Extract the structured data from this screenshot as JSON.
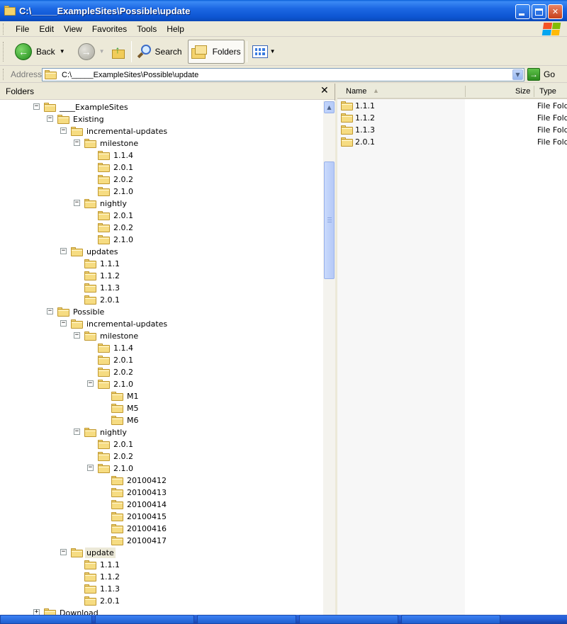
{
  "window": {
    "title": "C:\\_____ExampleSites\\Possible\\update"
  },
  "menu": [
    "File",
    "Edit",
    "View",
    "Favorites",
    "Tools",
    "Help"
  ],
  "toolbar": {
    "back_label": "Back",
    "search_label": "Search",
    "folders_label": "Folders"
  },
  "address": {
    "label": "Address",
    "value": "C:\\_____ExampleSites\\Possible\\update",
    "go_label": "Go"
  },
  "folders_pane": {
    "title": "Folders",
    "tree": [
      {
        "label": "____ExampleSites",
        "level": 0,
        "expander": "−"
      },
      {
        "label": "Existing",
        "level": 1,
        "expander": "−"
      },
      {
        "label": "incremental-updates",
        "level": 2,
        "expander": "−"
      },
      {
        "label": "milestone",
        "level": 3,
        "expander": "−"
      },
      {
        "label": "1.1.4",
        "level": 4,
        "expander": ""
      },
      {
        "label": "2.0.1",
        "level": 4,
        "expander": ""
      },
      {
        "label": "2.0.2",
        "level": 4,
        "expander": ""
      },
      {
        "label": "2.1.0",
        "level": 4,
        "expander": ""
      },
      {
        "label": "nightly",
        "level": 3,
        "expander": "−"
      },
      {
        "label": "2.0.1",
        "level": 4,
        "expander": ""
      },
      {
        "label": "2.0.2",
        "level": 4,
        "expander": ""
      },
      {
        "label": "2.1.0",
        "level": 4,
        "expander": ""
      },
      {
        "label": "updates",
        "level": 2,
        "expander": "−"
      },
      {
        "label": "1.1.1",
        "level": 3,
        "expander": ""
      },
      {
        "label": "1.1.2",
        "level": 3,
        "expander": ""
      },
      {
        "label": "1.1.3",
        "level": 3,
        "expander": ""
      },
      {
        "label": "2.0.1",
        "level": 3,
        "expander": ""
      },
      {
        "label": "Possible",
        "level": 1,
        "expander": "−"
      },
      {
        "label": "incremental-updates",
        "level": 2,
        "expander": "−"
      },
      {
        "label": "milestone",
        "level": 3,
        "expander": "−"
      },
      {
        "label": "1.1.4",
        "level": 4,
        "expander": ""
      },
      {
        "label": "2.0.1",
        "level": 4,
        "expander": ""
      },
      {
        "label": "2.0.2",
        "level": 4,
        "expander": ""
      },
      {
        "label": "2.1.0",
        "level": 4,
        "expander": "−"
      },
      {
        "label": "M1",
        "level": 5,
        "expander": ""
      },
      {
        "label": "M5",
        "level": 5,
        "expander": ""
      },
      {
        "label": "M6",
        "level": 5,
        "expander": ""
      },
      {
        "label": "nightly",
        "level": 3,
        "expander": "−"
      },
      {
        "label": "2.0.1",
        "level": 4,
        "expander": ""
      },
      {
        "label": "2.0.2",
        "level": 4,
        "expander": ""
      },
      {
        "label": "2.1.0",
        "level": 4,
        "expander": "−"
      },
      {
        "label": "20100412",
        "level": 5,
        "expander": ""
      },
      {
        "label": "20100413",
        "level": 5,
        "expander": ""
      },
      {
        "label": "20100414",
        "level": 5,
        "expander": ""
      },
      {
        "label": "20100415",
        "level": 5,
        "expander": ""
      },
      {
        "label": "20100416",
        "level": 5,
        "expander": ""
      },
      {
        "label": "20100417",
        "level": 5,
        "expander": ""
      },
      {
        "label": "update",
        "level": 2,
        "expander": "−",
        "selected": true
      },
      {
        "label": "1.1.1",
        "level": 3,
        "expander": ""
      },
      {
        "label": "1.1.2",
        "level": 3,
        "expander": ""
      },
      {
        "label": "1.1.3",
        "level": 3,
        "expander": ""
      },
      {
        "label": "2.0.1",
        "level": 3,
        "expander": ""
      },
      {
        "label": "Download",
        "level": 0,
        "expander": "+"
      }
    ]
  },
  "list_pane": {
    "columns": {
      "name": "Name",
      "size": "Size",
      "type": "Type"
    },
    "items": [
      {
        "name": "1.1.1",
        "size": "",
        "type": "File Folder"
      },
      {
        "name": "1.1.2",
        "size": "",
        "type": "File Folder"
      },
      {
        "name": "1.1.3",
        "size": "",
        "type": "File Folder"
      },
      {
        "name": "2.0.1",
        "size": "",
        "type": "File Folder"
      }
    ]
  },
  "colors": {
    "titlebar": "#0d55d2",
    "folder": "#f6dc82",
    "chrome": "#ece9d8"
  }
}
